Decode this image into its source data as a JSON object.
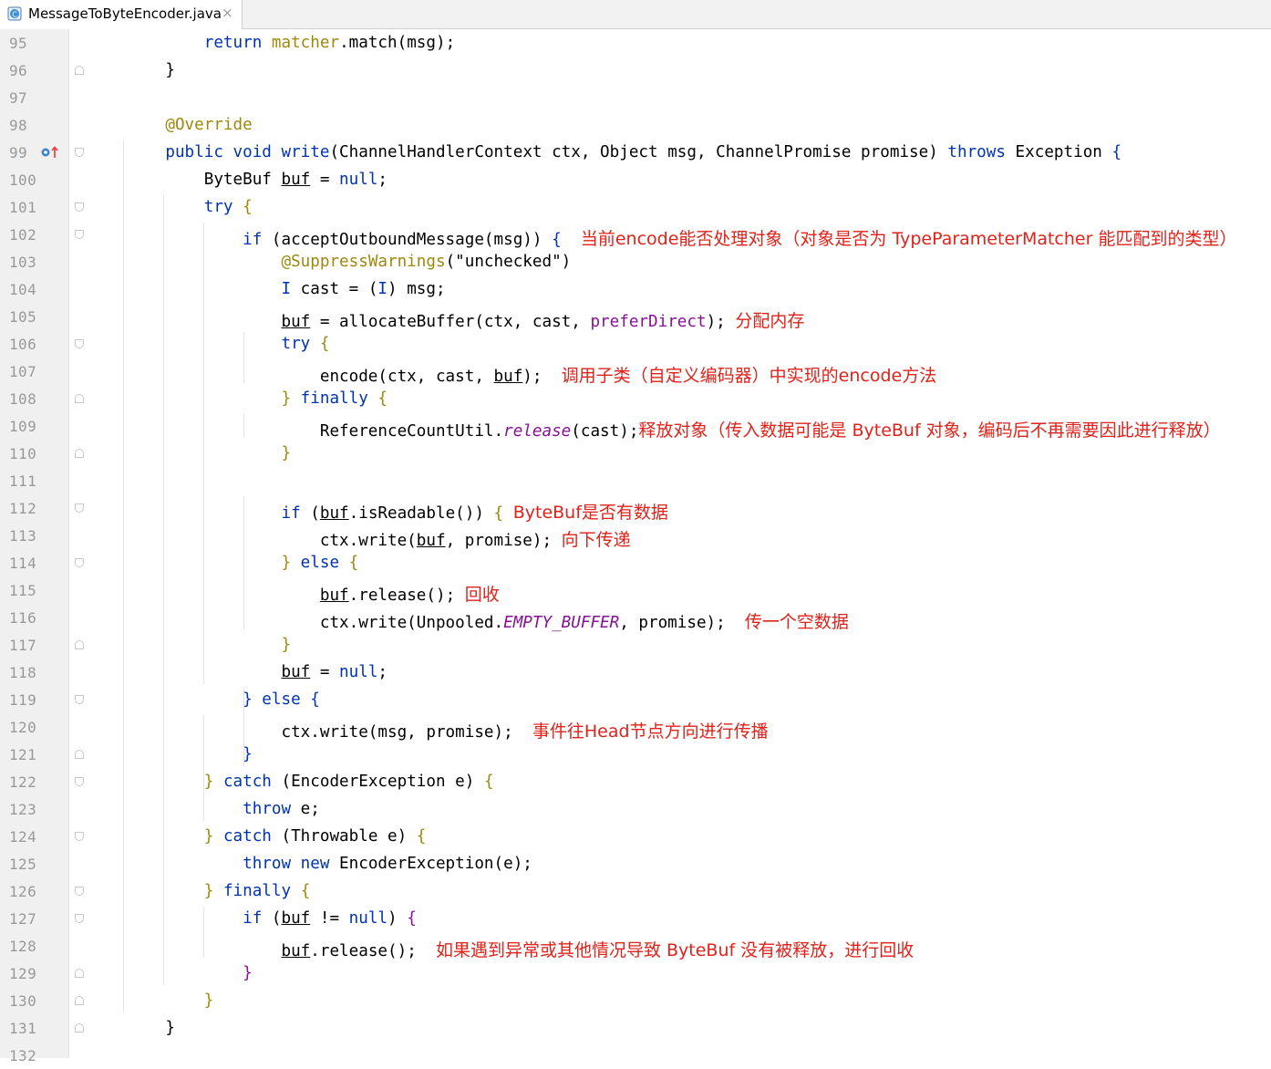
{
  "tab": {
    "filename": "MessageToByteEncoder.java",
    "icon": "java-class-icon",
    "close": "×"
  },
  "gutter": {
    "override_marker": "override-method-icon"
  },
  "colors": {
    "keyword": "#0033b3",
    "annotation": "#9e880d",
    "member": "#871094",
    "comment_note": "#e1221a"
  },
  "lines": [
    {
      "n": "95",
      "fold": "",
      "segs": [
        [
          "t",
          "        "
        ],
        [
          "kw",
          "return"
        ],
        [
          "t",
          " "
        ],
        [
          "ann",
          "matcher"
        ],
        [
          "t",
          ".match(msg);"
        ]
      ]
    },
    {
      "n": "96",
      "fold": "close",
      "segs": [
        [
          "t",
          "    }"
        ]
      ]
    },
    {
      "n": "97",
      "fold": "",
      "segs": []
    },
    {
      "n": "98",
      "fold": "",
      "segs": [
        [
          "ann",
          "    @Override"
        ]
      ]
    },
    {
      "n": "99",
      "fold": "open",
      "override": true,
      "segs": [
        [
          "t",
          "    "
        ],
        [
          "kw",
          "public"
        ],
        [
          "t",
          " "
        ],
        [
          "kw",
          "void"
        ],
        [
          "t",
          " "
        ],
        [
          "kw",
          "write"
        ],
        [
          "t",
          "(ChannelHandlerContext ctx, Object msg, ChannelPromise promise) "
        ],
        [
          "kw",
          "throws"
        ],
        [
          "t",
          " Exception "
        ],
        [
          "kw",
          "{"
        ]
      ]
    },
    {
      "n": "100",
      "fold": "",
      "segs": [
        [
          "t",
          "        ByteBuf "
        ],
        [
          "u",
          "buf"
        ],
        [
          "t",
          " = "
        ],
        [
          "kw",
          "null"
        ],
        [
          "t",
          ";"
        ]
      ]
    },
    {
      "n": "101",
      "fold": "open",
      "segs": [
        [
          "t",
          "        "
        ],
        [
          "kw",
          "try"
        ],
        [
          "t",
          " "
        ],
        [
          "ann",
          "{"
        ]
      ]
    },
    {
      "n": "102",
      "fold": "open",
      "segs": [
        [
          "t",
          "            "
        ],
        [
          "kw",
          "if"
        ],
        [
          "t",
          " (acceptOutboundMessage(msg)) "
        ],
        [
          "kw",
          "{"
        ],
        [
          "t",
          "  "
        ],
        [
          "cm",
          "当前encode能否处理对象（对象是否为 TypeParameterMatcher 能匹配到的类型）"
        ]
      ]
    },
    {
      "n": "103",
      "fold": "",
      "segs": [
        [
          "t",
          "                "
        ],
        [
          "ann",
          "@SuppressWarnings"
        ],
        [
          "t",
          "(\"unchecked\")"
        ]
      ]
    },
    {
      "n": "104",
      "fold": "",
      "segs": [
        [
          "t",
          "                "
        ],
        [
          "kw",
          "I"
        ],
        [
          "t",
          " cast = ("
        ],
        [
          "kw",
          "I"
        ],
        [
          "t",
          ") msg;"
        ]
      ]
    },
    {
      "n": "105",
      "fold": "",
      "segs": [
        [
          "t",
          "                "
        ],
        [
          "u",
          "buf"
        ],
        [
          "t",
          " = allocateBuffer(ctx, cast, "
        ],
        [
          "mem",
          "preferDirect"
        ],
        [
          "t",
          "); "
        ],
        [
          "cm",
          "分配内存"
        ]
      ]
    },
    {
      "n": "106",
      "fold": "open",
      "segs": [
        [
          "t",
          "                "
        ],
        [
          "kw",
          "try"
        ],
        [
          "t",
          " "
        ],
        [
          "ann",
          "{"
        ]
      ]
    },
    {
      "n": "107",
      "fold": "",
      "segs": [
        [
          "t",
          "                    encode(ctx, cast, "
        ],
        [
          "u",
          "buf"
        ],
        [
          "t",
          ");  "
        ],
        [
          "cm",
          "调用子类（自定义编码器）中实现的encode方法"
        ]
      ]
    },
    {
      "n": "108",
      "fold": "close",
      "segs": [
        [
          "t",
          "                "
        ],
        [
          "ann",
          "}"
        ],
        [
          "t",
          " "
        ],
        [
          "kw",
          "finally"
        ],
        [
          "t",
          " "
        ],
        [
          "ann",
          "{"
        ]
      ]
    },
    {
      "n": "109",
      "fold": "",
      "segs": [
        [
          "t",
          "                    ReferenceCountUtil."
        ],
        [
          "it",
          "release"
        ],
        [
          "t",
          "(cast);"
        ],
        [
          "cm",
          "释放对象（传入数据可能是 ByteBuf 对象，编码后不再需要因此进行释放）"
        ]
      ]
    },
    {
      "n": "110",
      "fold": "close",
      "segs": [
        [
          "t",
          "                "
        ],
        [
          "ann",
          "}"
        ]
      ]
    },
    {
      "n": "111",
      "fold": "",
      "segs": []
    },
    {
      "n": "112",
      "fold": "open",
      "segs": [
        [
          "t",
          "                "
        ],
        [
          "kw",
          "if"
        ],
        [
          "t",
          " ("
        ],
        [
          "u",
          "buf"
        ],
        [
          "t",
          ".isReadable()) "
        ],
        [
          "ann",
          "{"
        ],
        [
          "t",
          " "
        ],
        [
          "cm",
          "ByteBuf是否有数据"
        ]
      ]
    },
    {
      "n": "113",
      "fold": "",
      "segs": [
        [
          "t",
          "                    ctx.write("
        ],
        [
          "u",
          "buf"
        ],
        [
          "t",
          ", promise); "
        ],
        [
          "cm",
          "向下传递"
        ]
      ]
    },
    {
      "n": "114",
      "fold": "open",
      "segs": [
        [
          "t",
          "                "
        ],
        [
          "ann",
          "}"
        ],
        [
          "t",
          " "
        ],
        [
          "kw",
          "else"
        ],
        [
          "t",
          " "
        ],
        [
          "ann",
          "{"
        ]
      ]
    },
    {
      "n": "115",
      "fold": "",
      "segs": [
        [
          "t",
          "                    "
        ],
        [
          "u",
          "buf"
        ],
        [
          "t",
          ".release(); "
        ],
        [
          "cm",
          "回收"
        ]
      ]
    },
    {
      "n": "116",
      "fold": "",
      "segs": [
        [
          "t",
          "                    ctx.write(Unpooled."
        ],
        [
          "it",
          "EMPTY_BUFFER"
        ],
        [
          "t",
          ", promise);  "
        ],
        [
          "cm",
          "传一个空数据"
        ]
      ]
    },
    {
      "n": "117",
      "fold": "close",
      "segs": [
        [
          "t",
          "                "
        ],
        [
          "ann",
          "}"
        ]
      ]
    },
    {
      "n": "118",
      "fold": "",
      "segs": [
        [
          "t",
          "                "
        ],
        [
          "u",
          "buf"
        ],
        [
          "t",
          " = "
        ],
        [
          "kw",
          "null"
        ],
        [
          "t",
          ";"
        ]
      ]
    },
    {
      "n": "119",
      "fold": "open",
      "segs": [
        [
          "t",
          "            "
        ],
        [
          "kw",
          "}"
        ],
        [
          "t",
          " "
        ],
        [
          "kw",
          "else"
        ],
        [
          "t",
          " "
        ],
        [
          "kw",
          "{"
        ]
      ]
    },
    {
      "n": "120",
      "fold": "",
      "segs": [
        [
          "t",
          "                ctx.write(msg, promise);  "
        ],
        [
          "cm",
          "事件往Head节点方向进行传播"
        ]
      ]
    },
    {
      "n": "121",
      "fold": "close",
      "segs": [
        [
          "t",
          "            "
        ],
        [
          "kw",
          "}"
        ]
      ]
    },
    {
      "n": "122",
      "fold": "open",
      "segs": [
        [
          "t",
          "        "
        ],
        [
          "ann",
          "}"
        ],
        [
          "t",
          " "
        ],
        [
          "kw",
          "catch"
        ],
        [
          "t",
          " (EncoderException e) "
        ],
        [
          "ann",
          "{"
        ]
      ]
    },
    {
      "n": "123",
      "fold": "",
      "segs": [
        [
          "t",
          "            "
        ],
        [
          "kw",
          "throw"
        ],
        [
          "t",
          " e;"
        ]
      ]
    },
    {
      "n": "124",
      "fold": "open",
      "segs": [
        [
          "t",
          "        "
        ],
        [
          "ann",
          "}"
        ],
        [
          "t",
          " "
        ],
        [
          "kw",
          "catch"
        ],
        [
          "t",
          " (Throwable e) "
        ],
        [
          "ann",
          "{"
        ]
      ]
    },
    {
      "n": "125",
      "fold": "",
      "segs": [
        [
          "t",
          "            "
        ],
        [
          "kw",
          "throw"
        ],
        [
          "t",
          " "
        ],
        [
          "kw",
          "new"
        ],
        [
          "t",
          " EncoderException(e);"
        ]
      ]
    },
    {
      "n": "126",
      "fold": "open",
      "segs": [
        [
          "t",
          "        "
        ],
        [
          "ann",
          "}"
        ],
        [
          "t",
          " "
        ],
        [
          "kw",
          "finally"
        ],
        [
          "t",
          " "
        ],
        [
          "ann",
          "{"
        ]
      ]
    },
    {
      "n": "127",
      "fold": "open",
      "segs": [
        [
          "t",
          "            "
        ],
        [
          "kw",
          "if"
        ],
        [
          "t",
          " ("
        ],
        [
          "u",
          "buf"
        ],
        [
          "t",
          " != "
        ],
        [
          "kw",
          "null"
        ],
        [
          "t",
          ") "
        ],
        [
          "mem",
          "{"
        ]
      ]
    },
    {
      "n": "128",
      "fold": "",
      "segs": [
        [
          "t",
          "                "
        ],
        [
          "u",
          "buf"
        ],
        [
          "t",
          ".release();  "
        ],
        [
          "cm",
          "如果遇到异常或其他情况导致 ByteBuf 没有被释放，进行回收"
        ]
      ]
    },
    {
      "n": "129",
      "fold": "close",
      "segs": [
        [
          "t",
          "            "
        ],
        [
          "mem",
          "}"
        ]
      ]
    },
    {
      "n": "130",
      "fold": "close",
      "segs": [
        [
          "t",
          "        "
        ],
        [
          "ann",
          "}"
        ]
      ]
    },
    {
      "n": "131",
      "fold": "close",
      "segs": [
        [
          "t",
          "    }"
        ]
      ]
    },
    {
      "n": "132",
      "fold": "",
      "segs": []
    }
  ]
}
